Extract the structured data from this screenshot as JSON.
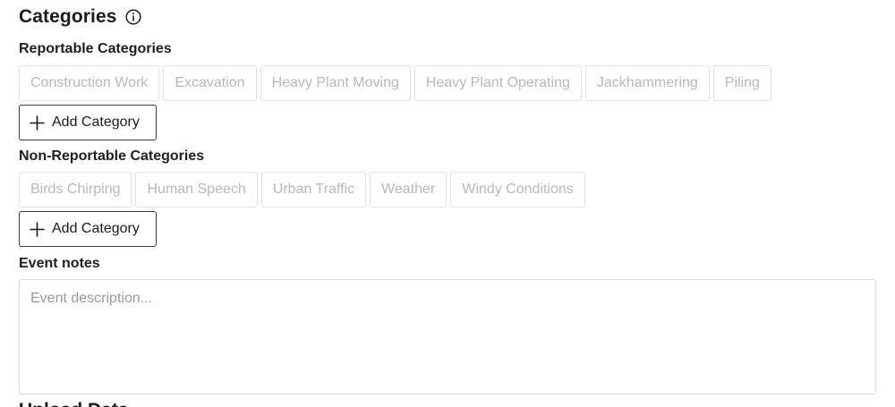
{
  "header": {
    "title": "Categories",
    "info_icon": "info-circle-icon"
  },
  "reportable": {
    "label": "Reportable Categories",
    "chips": [
      "Construction Work",
      "Excavation",
      "Heavy Plant Moving",
      "Heavy Plant Operating",
      "Jackhammering",
      "Piling"
    ],
    "add_label": "Add Category"
  },
  "non_reportable": {
    "label": "Non-Reportable Categories",
    "chips": [
      "Birds Chirping",
      "Human Speech",
      "Urban Traffic",
      "Weather",
      "Windy Conditions"
    ],
    "add_label": "Add Category"
  },
  "notes": {
    "label": "Event notes",
    "value": "",
    "placeholder": "Event description..."
  },
  "next_section": {
    "title": "Upload Data"
  },
  "colors": {
    "chip_border": "#e1e1e1",
    "chip_text": "#b8b8b8",
    "button_border": "#3c3c3c",
    "text": "#1c1c1c"
  }
}
